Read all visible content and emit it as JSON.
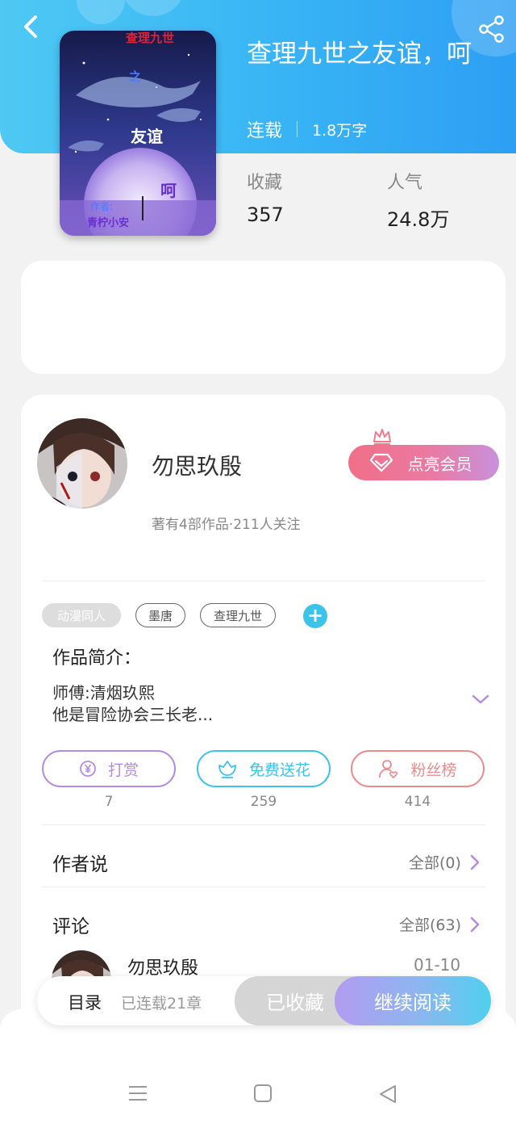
{
  "book": {
    "title": "查理九世之友谊，呵",
    "status": "连载",
    "word_count": "1.8万字",
    "favorites_label": "收藏",
    "favorites_value": "357",
    "popularity_label": "人气",
    "popularity_value": "24.8万"
  },
  "cover": {
    "text_top": "查理九世",
    "text_zhi": "之",
    "text_youyi": "友谊",
    "text_he": "呵",
    "text_author_label": "作者:",
    "text_author": "青柠小安"
  },
  "author": {
    "name": "勿思玖殷",
    "stats": "著有4部作品·211人关注",
    "vip_label": "点亮会员"
  },
  "tags": [
    "动漫同人",
    "墨唐",
    "查理九世"
  ],
  "intro": {
    "title": "作品简介：",
    "line1": "师傅:清烟玖熙",
    "line2": "他是冒险协会三长老..."
  },
  "actions": [
    {
      "label": "打赏",
      "count": "7",
      "color": "#b48be0"
    },
    {
      "label": "免费送花",
      "count": "259",
      "color": "#3cc3e8"
    },
    {
      "label": "粉丝榜",
      "count": "414",
      "color": "#ea8c8c"
    }
  ],
  "author_says": {
    "title": "作者说",
    "link": "全部(0)"
  },
  "comments": {
    "title": "评论",
    "link": "全部(63)",
    "first": {
      "name": "勿思玖殷",
      "date": "01-10"
    }
  },
  "bottom_bar": {
    "toc_label": "目录",
    "toc_sub": "已连载21章",
    "favorited_label": "已收藏",
    "continue_label": "继续阅读"
  },
  "colors": {
    "header": "#38b4f5",
    "accent_purple": "#b48be0",
    "accent_teal": "#3cc3e8",
    "accent_red": "#ea8c8c"
  }
}
